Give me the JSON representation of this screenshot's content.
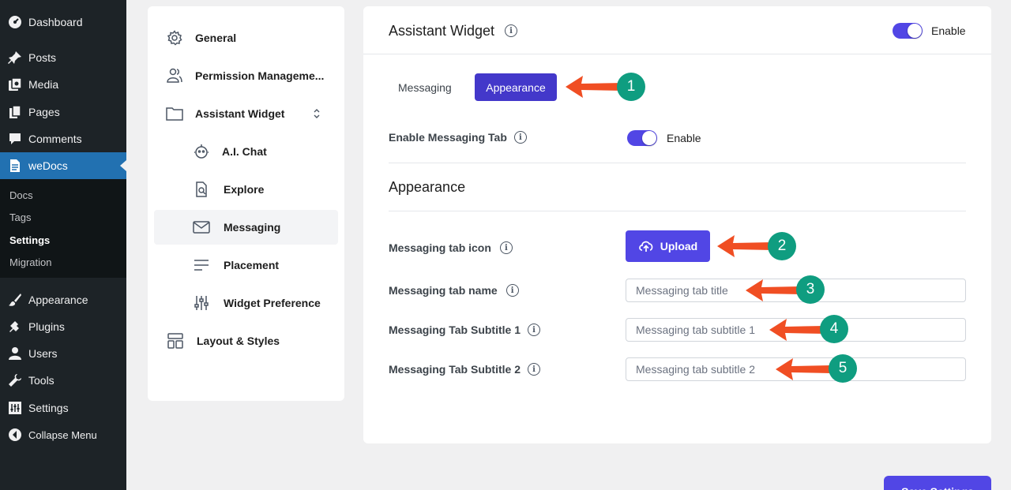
{
  "wp_menu": {
    "dashboard": "Dashboard",
    "posts": "Posts",
    "media": "Media",
    "pages": "Pages",
    "comments": "Comments",
    "wedocs": "weDocs",
    "submenu": [
      "Docs",
      "Tags",
      "Settings",
      "Migration"
    ],
    "appearance": "Appearance",
    "plugins": "Plugins",
    "users": "Users",
    "tools": "Tools",
    "settings": "Settings",
    "collapse": "Collapse Menu"
  },
  "settings_nav": {
    "general": "General",
    "permission": "Permission Manageme...",
    "assistant_widget": "Assistant Widget",
    "ai_chat": "A.I. Chat",
    "explore": "Explore",
    "messaging": "Messaging",
    "placement": "Placement",
    "widget_preference": "Widget Preference",
    "layout_styles": "Layout & Styles"
  },
  "main": {
    "title": "Assistant Widget",
    "enable_label": "Enable",
    "tabs": [
      "Messaging",
      "Appearance"
    ],
    "enable_messaging_tab": "Enable Messaging Tab",
    "enable_messaging_value": "Enable",
    "section_title": "Appearance",
    "tab_icon_label": "Messaging tab icon",
    "upload_label": "Upload",
    "tab_name_label": "Messaging tab name",
    "tab_name_placeholder": "Messaging tab title",
    "subtitle1_label": "Messaging Tab Subtitle 1",
    "subtitle1_placeholder": "Messaging tab subtitle 1",
    "subtitle2_label": "Messaging Tab Subtitle 2",
    "subtitle2_placeholder": "Messaging tab subtitle 2",
    "info_glyph": "i"
  },
  "annotations": [
    "1",
    "2",
    "3",
    "4",
    "5"
  ],
  "save_button": "Save Settings",
  "colors": {
    "accent": "#5146e5",
    "wp_sidebar": "#1d2327",
    "wp_active": "#2271b1",
    "arrow": "#f04e23",
    "badge": "#0f9d80"
  }
}
